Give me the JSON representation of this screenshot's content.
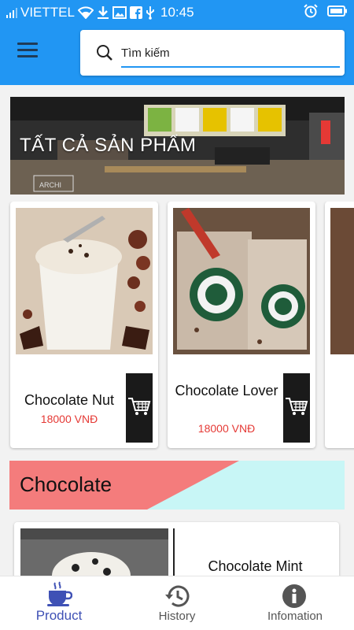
{
  "status_bar": {
    "carrier": "VIETTEL",
    "time": "10:45"
  },
  "search": {
    "placeholder": "Tìm kiếm"
  },
  "banner": {
    "title": "TẤT CẢ SẢN PHẨM",
    "sign_text": "ARCHI"
  },
  "products": [
    {
      "name": "Chocolate Nut",
      "price": "18000 VNĐ"
    },
    {
      "name": "Chocolate Lover",
      "price": "18000 VNĐ"
    }
  ],
  "category": {
    "title": "Chocolate",
    "colors": {
      "left": "#f47c7c",
      "right": "#c8f6f6"
    }
  },
  "list_items": [
    {
      "name": "Chocolate Mint"
    }
  ],
  "bottom_nav": [
    {
      "label": "Product",
      "icon": "coffee-cup-icon",
      "active": true
    },
    {
      "label": "History",
      "icon": "history-icon",
      "active": false
    },
    {
      "label": "Infomation",
      "icon": "info-icon",
      "active": false
    }
  ],
  "colors": {
    "primary": "#2196f3",
    "price": "#e53935",
    "active_nav": "#3f51b5"
  }
}
